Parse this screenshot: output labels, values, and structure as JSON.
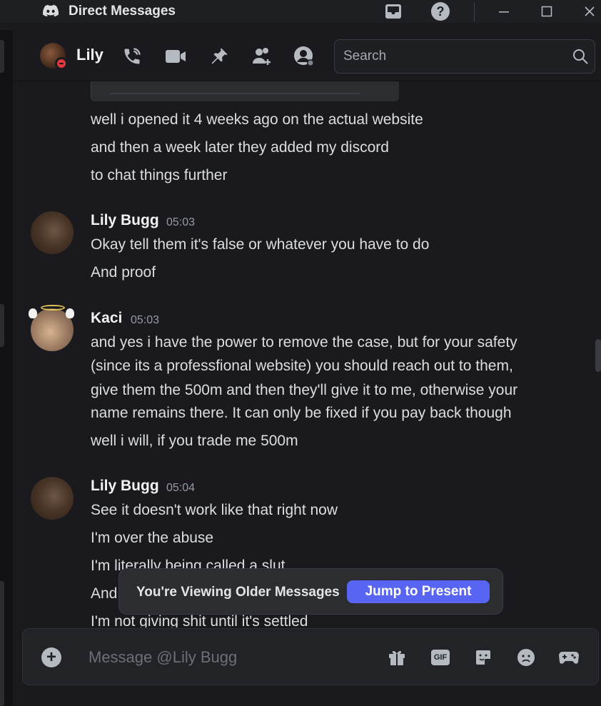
{
  "window": {
    "title": "Direct Messages",
    "icons": {
      "app": "discord-logo-icon",
      "inbox": "inbox-icon",
      "help": "help-icon",
      "minimize": "minimize-icon",
      "maximize": "maximize-icon",
      "close": "close-icon"
    }
  },
  "header": {
    "name": "Lily",
    "status": "do-not-disturb",
    "icons": [
      "voice-call-icon",
      "video-call-icon",
      "pinned-messages-icon",
      "add-friends-to-dm-icon",
      "user-profile-icon"
    ],
    "search": {
      "placeholder": "Search"
    }
  },
  "messages": {
    "continuation": [
      "well i opened it 4 weeks ago on the actual website",
      "and then a week later they added my discord",
      "to chat things further"
    ],
    "groups": [
      {
        "author": "Lily Bugg",
        "time": "05:03",
        "lines": [
          "Okay tell them it's false or whatever you have to do",
          "And proof"
        ]
      },
      {
        "author": "Kaci",
        "time": "05:03",
        "lines": [
          "and yes i have the power to remove the case, but for your safety",
          "(since its a professfional website) you should reach out to them,",
          "give them the 500m and then they'll give it to me, otherwise your",
          "name remains there. It can only be fixed if you pay back though",
          "well i will, if you trade me 500m"
        ]
      },
      {
        "author": "Lily Bugg",
        "time": "05:04",
        "lines": [
          "See it doesn't work like that right now",
          "I'm over the abuse",
          "I'm literally being called a slut",
          "And",
          "I'm not giving shit until it's settled"
        ]
      }
    ]
  },
  "older_messages": {
    "text": "You're Viewing Older Messages",
    "button": "Jump to Present"
  },
  "composer": {
    "placeholder": "Message @Lily Bugg",
    "gif_label": "GIF",
    "icons": [
      "add-attachment-icon",
      "gift-icon",
      "gif-icon",
      "sticker-icon",
      "emoji-icon",
      "activities-icon"
    ]
  },
  "colors": {
    "background": "#1a1a1e",
    "accent": "#5865f2",
    "dnd": "#e0383e",
    "text": "#dbdee1"
  }
}
